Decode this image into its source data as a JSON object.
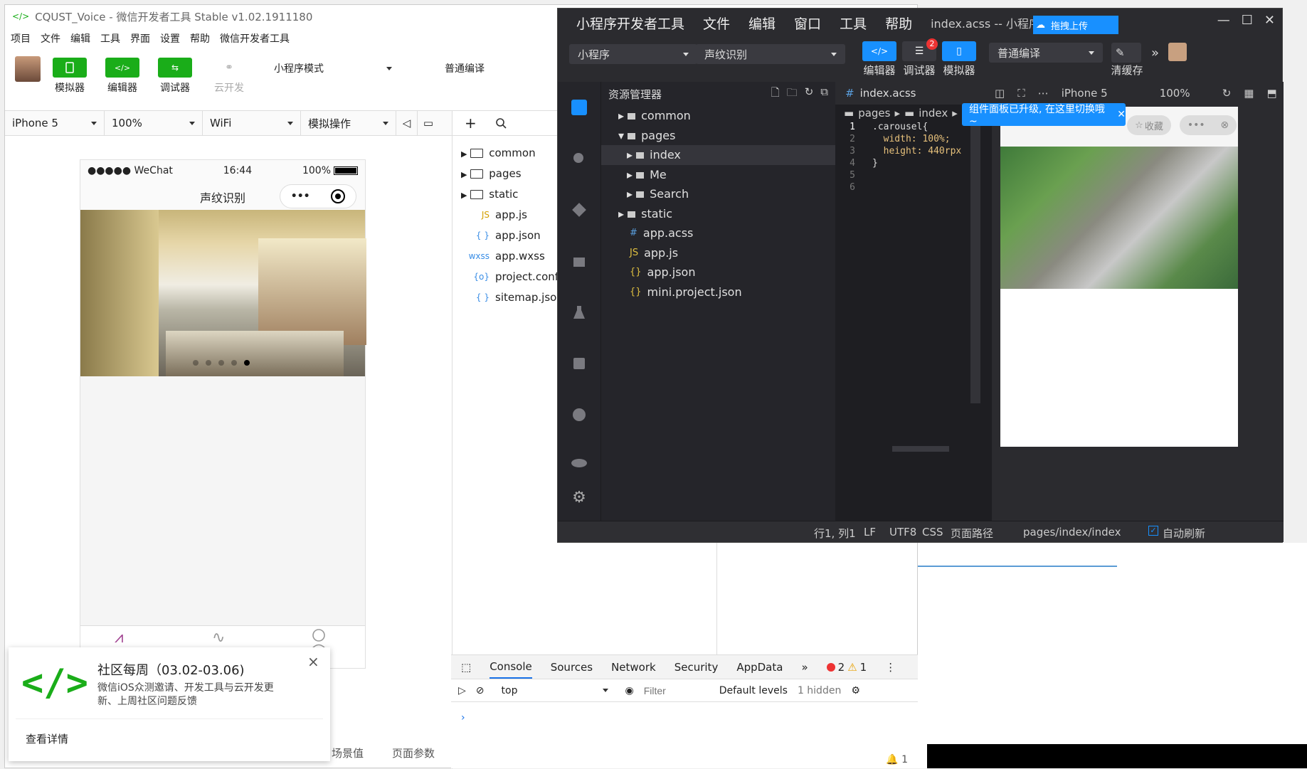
{
  "winA": {
    "title": "CQUST_Voice - 微信开发者工具 Stable v1.02.1911180",
    "menu": [
      "项目",
      "文件",
      "编辑",
      "工具",
      "界面",
      "设置",
      "帮助",
      "微信开发者工具"
    ],
    "tool_buttons": {
      "simulator": "模拟器",
      "editor": "编辑器",
      "debugger": "调试器",
      "cloud": "云开发"
    },
    "mode_select": "小程序模式",
    "compile_select": "普通编译",
    "device": "iPhone 5",
    "zoom": "100%",
    "network": "WiFi",
    "sim_ops": "模拟操作",
    "phone": {
      "carrier": "●●●●● WeChat",
      "time": "16:44",
      "battery": "100%",
      "nav_title": "声纹识别",
      "carousel_dots": 5,
      "active_dot": 5
    },
    "files": [
      {
        "type": "folder",
        "name": "common"
      },
      {
        "type": "folder",
        "name": "pages"
      },
      {
        "type": "folder",
        "name": "static"
      },
      {
        "type": "js",
        "icon": "JS",
        "name": "app.js"
      },
      {
        "type": "json",
        "icon": "{ }",
        "name": "app.json"
      },
      {
        "type": "wxss",
        "icon": "wxss",
        "name": "app.wxss"
      },
      {
        "type": "config",
        "icon": "{o}",
        "name": "project.config"
      },
      {
        "type": "json",
        "icon": "{ }",
        "name": "sitemap.json"
      }
    ],
    "console": {
      "tabs": [
        "Console",
        "Sources",
        "Network",
        "Security",
        "AppData"
      ],
      "errors": "2",
      "warnings": "1",
      "context": "top",
      "filter_placeholder": "Filter",
      "levels": "Default levels",
      "hidden": "1 hidden",
      "bottom_count": "1"
    },
    "bottom_tabs": [
      "场景值",
      "页面参数"
    ],
    "notice": {
      "title": "社区每周（03.02-03.06)",
      "body": "微信iOS众测邀请、开发工具与云开发更新、上周社区问题反馈",
      "link": "查看详情"
    }
  },
  "winB": {
    "menu": [
      "小程序开发者工具",
      "文件",
      "编辑",
      "窗口",
      "工具",
      "帮助"
    ],
    "title": "index.acss -- 小程序开发者工具",
    "project_type": "小程序",
    "project_name": "声纹识别",
    "btns": {
      "editor": "编辑器",
      "debugger": "调试器",
      "simulator": "模拟器",
      "clear": "清缓存"
    },
    "debug_badge": "2",
    "compile": "普通编译",
    "upload": "拖拽上传",
    "explorer_title": "资源管理器",
    "tree": [
      {
        "depth": 1,
        "type": "folder",
        "name": "common",
        "open": false
      },
      {
        "depth": 1,
        "type": "folder",
        "name": "pages",
        "open": true
      },
      {
        "depth": 2,
        "type": "folder",
        "name": "index",
        "open": false,
        "selected": true
      },
      {
        "depth": 2,
        "type": "folder",
        "name": "Me",
        "open": false
      },
      {
        "depth": 2,
        "type": "folder",
        "name": "Search",
        "open": false
      },
      {
        "depth": 1,
        "type": "folder",
        "name": "static",
        "open": false
      },
      {
        "depth": 1,
        "type": "acss",
        "icon": "#",
        "name": "app.acss"
      },
      {
        "depth": 1,
        "type": "js",
        "icon": "JS",
        "name": "app.js"
      },
      {
        "depth": 1,
        "type": "json",
        "icon": "{}",
        "name": "app.json"
      },
      {
        "depth": 1,
        "type": "json",
        "icon": "{}",
        "name": "mini.project.json"
      }
    ],
    "editor_tab": "index.acss",
    "breadcrumb": [
      "pages",
      "index"
    ],
    "code_lines": [
      ".carousel{",
      "  width: 100%;",
      "  height: 440rpx",
      "}",
      "",
      ""
    ],
    "preview_device": "iPhone 5",
    "preview_zoom": "100%",
    "tooltip": "组件面板已升级, 在这里切换哦~",
    "fav": "收藏",
    "status": {
      "pos": "行1, 列1",
      "eol": "LF",
      "enc": "UTF8",
      "lang": "CSS",
      "page_path_label": "页面路径",
      "page_path": "pages/index/index",
      "auto_refresh": "自动刷新"
    }
  },
  "colors": {
    "wechat_green": "#1aad19",
    "dark_bg": "#2b2b2f",
    "accent_blue": "#1890ff"
  }
}
